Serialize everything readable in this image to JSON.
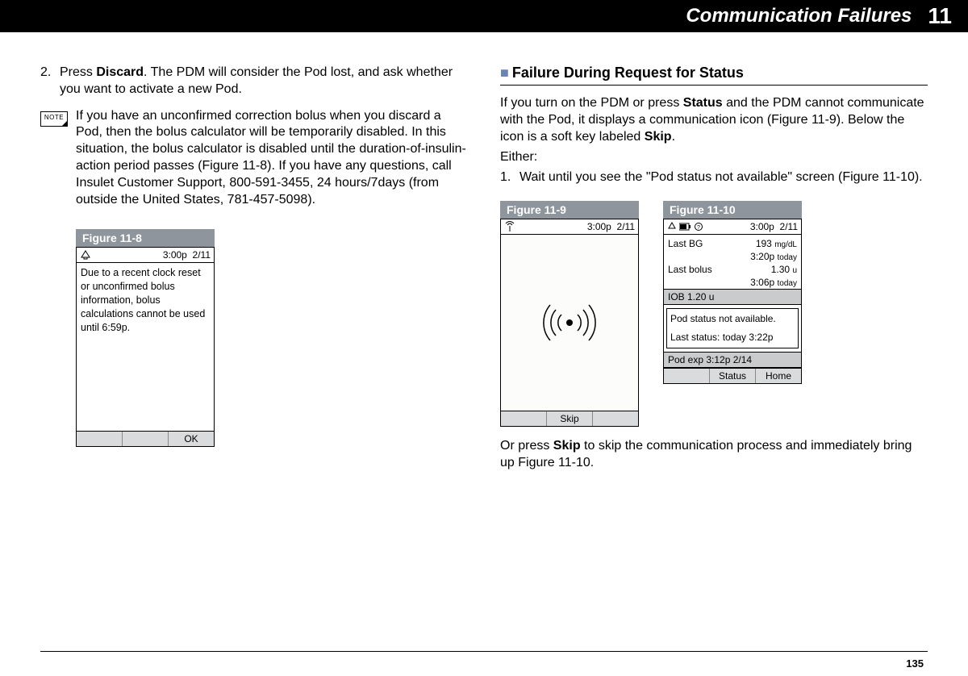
{
  "header": {
    "title": "Communication Failures",
    "chapter": "11"
  },
  "left": {
    "step2_num": "2.",
    "step2_text_a": "Press ",
    "step2_bold": "Discard",
    "step2_text_b": ". The PDM will consider the Pod lost, and ask whether you want to activate a new Pod.",
    "note_label": "NOTE",
    "note_text": "If you have an unconfirmed correction bolus when you discard a Pod, then the bolus calculator will be temporarily disabled. In this situation, the bolus calculator is disabled until the duration-of-insulin-action period passes (Figure 11-8). If you have any questions, call Insulet Customer Support, 800-591-3455, 24 hours/7days (from outside the United States, 781-457-5098).",
    "fig8": {
      "label": "Figure 11-8",
      "time": "3:00p",
      "date": "2/11",
      "body": "Due to a recent clock reset or unconfirmed bolus information, bolus calculations cannot be used until 6:59p.",
      "ok": "OK"
    }
  },
  "right": {
    "section": "Failure During Request for Status",
    "para1_a": "If you turn on the PDM or press ",
    "para1_b1": "Status",
    "para1_b": " and the PDM cannot communicate with the Pod, it displays a communication icon (Figure 11-9). Below the icon is a soft key labeled ",
    "para1_b2": "Skip",
    "para1_c": ".",
    "either": "Either:",
    "step1_num": "1.",
    "step1_text": "Wait until you see the \"Pod status not available\" screen (Figure 11-10).",
    "fig9": {
      "label": "Figure 11-9",
      "time": "3:00p",
      "date": "2/11",
      "skip": "Skip"
    },
    "fig10": {
      "label": "Figure 11-10",
      "time": "3:00p",
      "date": "2/11",
      "lastbg_label": "Last BG",
      "lastbg_val": "193",
      "lastbg_unit": "mg/dL",
      "lastbg_time": "3:20p",
      "lastbg_day": "today",
      "lastbolus_label": "Last bolus",
      "lastbolus_val": "1.30",
      "lastbolus_unit": "u",
      "lastbolus_time": "3:06p",
      "lastbolus_day": "today",
      "iob": "IOB  1.20 u",
      "status_line1": "Pod status not available.",
      "status_line2": "Last status: today 3:22p",
      "podexp": "Pod exp 3:12p 2/14",
      "sk_status": "Status",
      "sk_home": "Home"
    },
    "after_a": "Or press ",
    "after_bold": "Skip",
    "after_b": " to skip the communication process and immediately bring up Figure 11-10."
  },
  "page_number": "135"
}
